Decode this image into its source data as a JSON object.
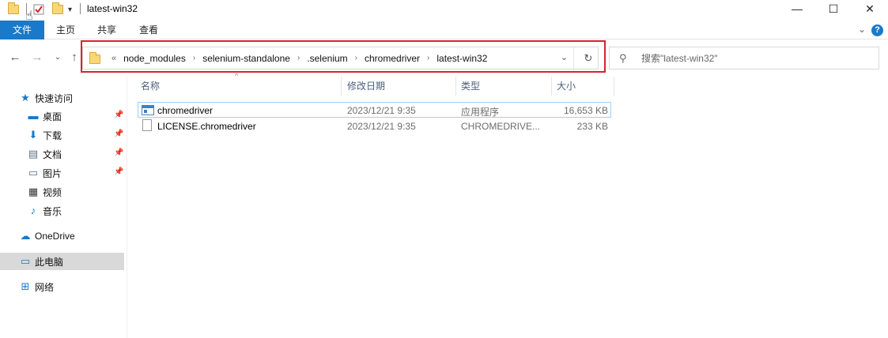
{
  "window": {
    "title": "latest-win32",
    "minimize_glyph": "—",
    "maximize_glyph": "☐",
    "close_glyph": "✕"
  },
  "quick_access_toolbar": {
    "icons": [
      "folder-icon",
      "properties-check-icon",
      "new-folder-icon",
      "customize-dropdown-icon"
    ]
  },
  "ribbon": {
    "tabs": [
      {
        "label": "文件"
      },
      {
        "label": "主页"
      },
      {
        "label": "共享"
      },
      {
        "label": "查看"
      }
    ],
    "help_glyph": "?"
  },
  "address": {
    "overflow": "«",
    "breadcrumbs": [
      "node_modules",
      "selenium-standalone",
      ".selenium",
      "chromedriver",
      "latest-win32"
    ],
    "highlight_color": "#d7232d"
  },
  "search": {
    "placeholder": "搜索\"latest-win32\""
  },
  "nav_pane": {
    "quick_access": "快速访问",
    "items": [
      {
        "label": "桌面",
        "pinned": true
      },
      {
        "label": "下载",
        "pinned": true
      },
      {
        "label": "文档",
        "pinned": true
      },
      {
        "label": "图片",
        "pinned": true
      },
      {
        "label": "视频",
        "pinned": false
      },
      {
        "label": "音乐",
        "pinned": false
      }
    ],
    "onedrive": "OneDrive",
    "this_pc": "此电脑",
    "network": "网络"
  },
  "file_list": {
    "columns": [
      "名称",
      "修改日期",
      "类型",
      "大小"
    ],
    "rows": [
      {
        "name": "chromedriver",
        "modified": "2023/12/21 9:35",
        "type": "应用程序",
        "size": "16,653 KB",
        "icon": "exe-icon"
      },
      {
        "name": "LICENSE.chromedriver",
        "modified": "2023/12/21 9:35",
        "type": "CHROMEDRIVE...",
        "size": "233 KB",
        "icon": "document-icon"
      }
    ]
  },
  "colors": {
    "file_tab": "#1979ca",
    "selection_border": "#99d1ff",
    "column_header_text": "#4c607a"
  }
}
